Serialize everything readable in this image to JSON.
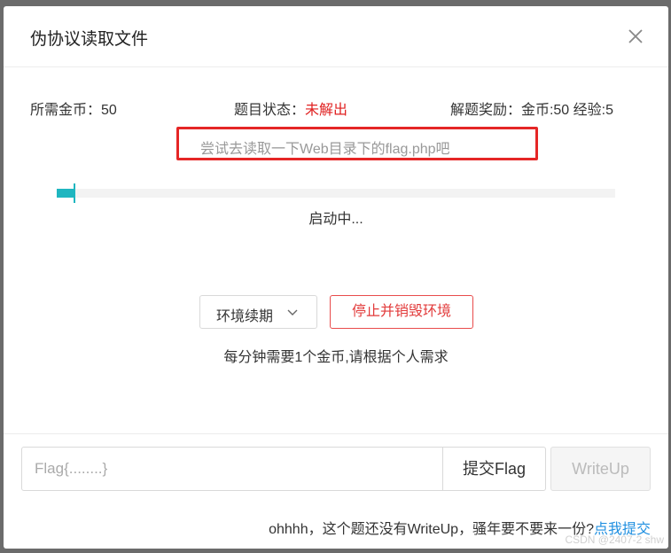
{
  "dialog": {
    "title": "伪协议读取文件",
    "close_icon": "close-icon"
  },
  "meta": {
    "cost_label": "所需金币：50",
    "status_label": "题目状态：",
    "status_value": "未解出",
    "reward_label": "解题奖励：金币:50 经验:5"
  },
  "hint": "尝试去读取一下Web目录下的flag.php吧",
  "progress": {
    "fraction": 0.03,
    "status_text": "启动中..."
  },
  "actions": {
    "renew_label": "环境续期",
    "destroy_label": "停止并销毁环境",
    "cost_note": "每分钟需要1个金币,请根据个人需求"
  },
  "flag_form": {
    "placeholder": "Flag{........}",
    "submit_label": "提交Flag",
    "writeup_label": "WriteUp"
  },
  "footer": {
    "note": "ohhhh，这个题还没有WriteUp，骚年要不要来一份?",
    "link_label": "点我提交"
  },
  "watermark": "CSDN @2407-2 shw",
  "colors": {
    "accent": "#1fb6c0",
    "danger": "#e02020",
    "link": "#1f8fe0"
  }
}
